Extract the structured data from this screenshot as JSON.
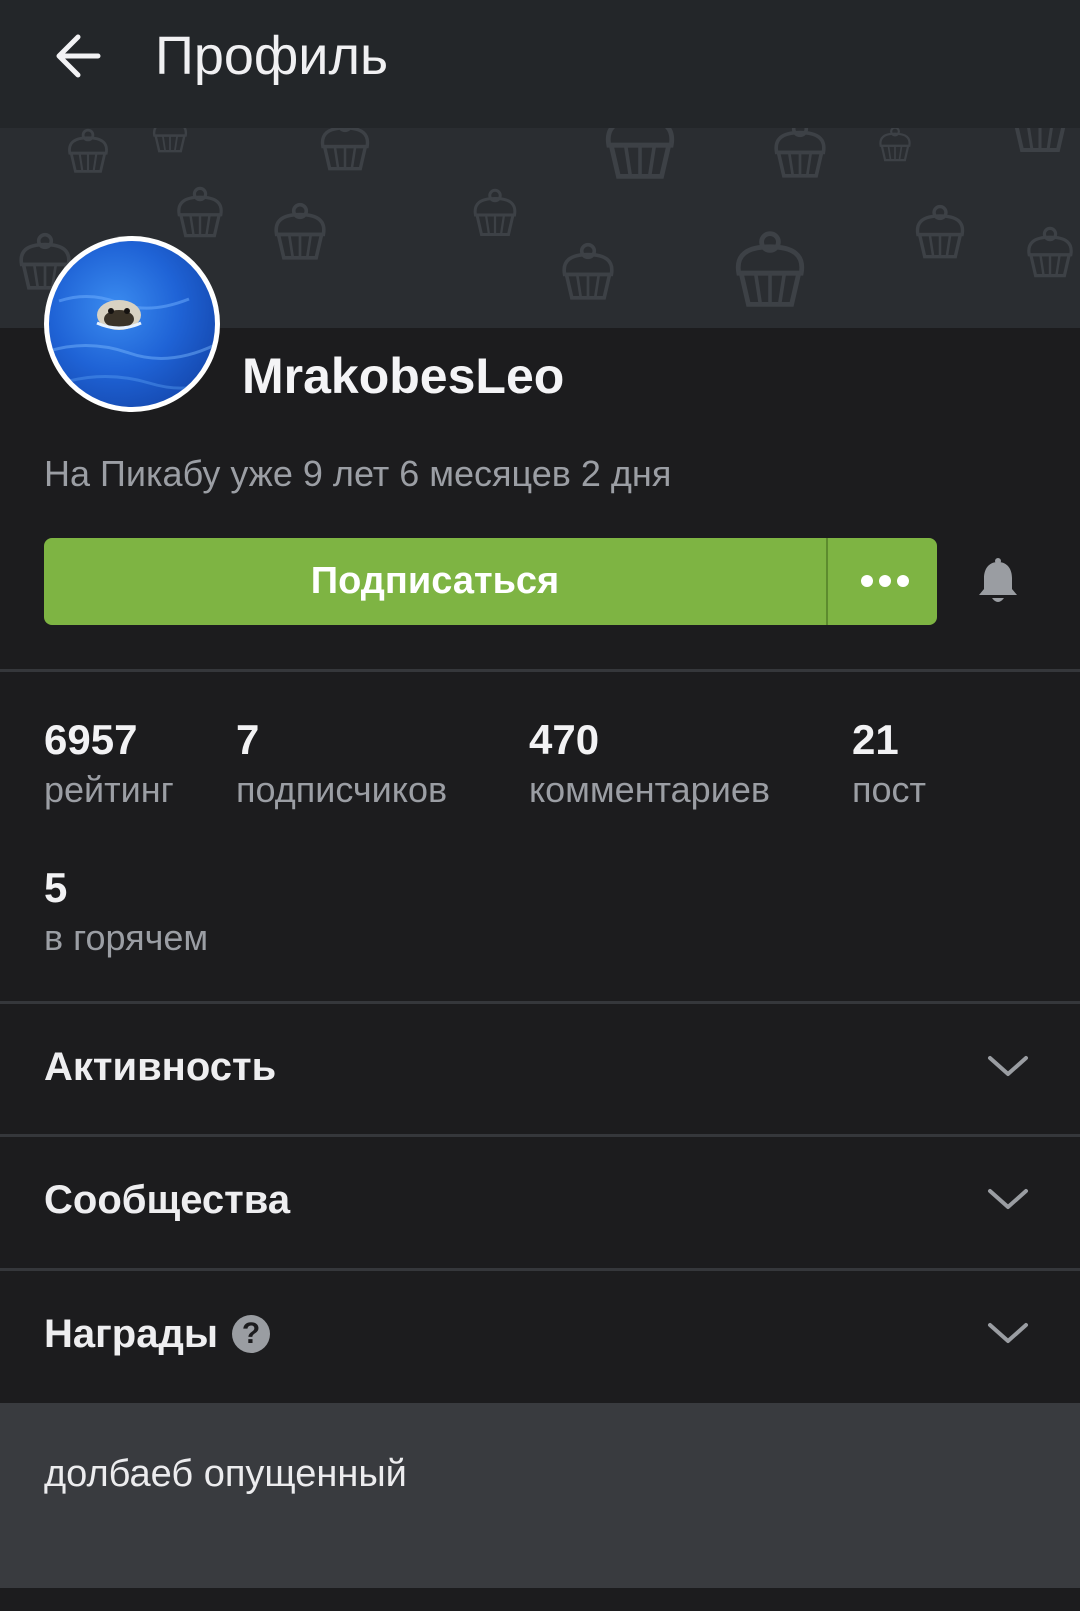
{
  "header": {
    "title": "Профиль",
    "back_icon": "arrow-left-icon"
  },
  "profile": {
    "username": "MrakobesLeo",
    "since": "На Пикабу уже 9 лет 6 месяцев 2 дня",
    "subscribe_label": "Подписаться",
    "more_icon": "more-dots-icon",
    "bell_icon": "bell-icon"
  },
  "stats": [
    {
      "value": "6957",
      "label": "рейтинг"
    },
    {
      "value": "7",
      "label": "подписчиков"
    },
    {
      "value": "470",
      "label": "комментариев"
    },
    {
      "value": "21",
      "label": "пост"
    },
    {
      "value": "5",
      "label": "в горячем"
    }
  ],
  "sections": [
    {
      "label": "Активность"
    },
    {
      "label": "Сообщества"
    },
    {
      "label": "Награды"
    }
  ],
  "awards_help": "?",
  "note": {
    "text": "долбаеб опущенный"
  },
  "colors": {
    "accent": "#7eb443",
    "background": "#1c1c1e",
    "header": "#232629",
    "note_bg": "#393b3f"
  }
}
